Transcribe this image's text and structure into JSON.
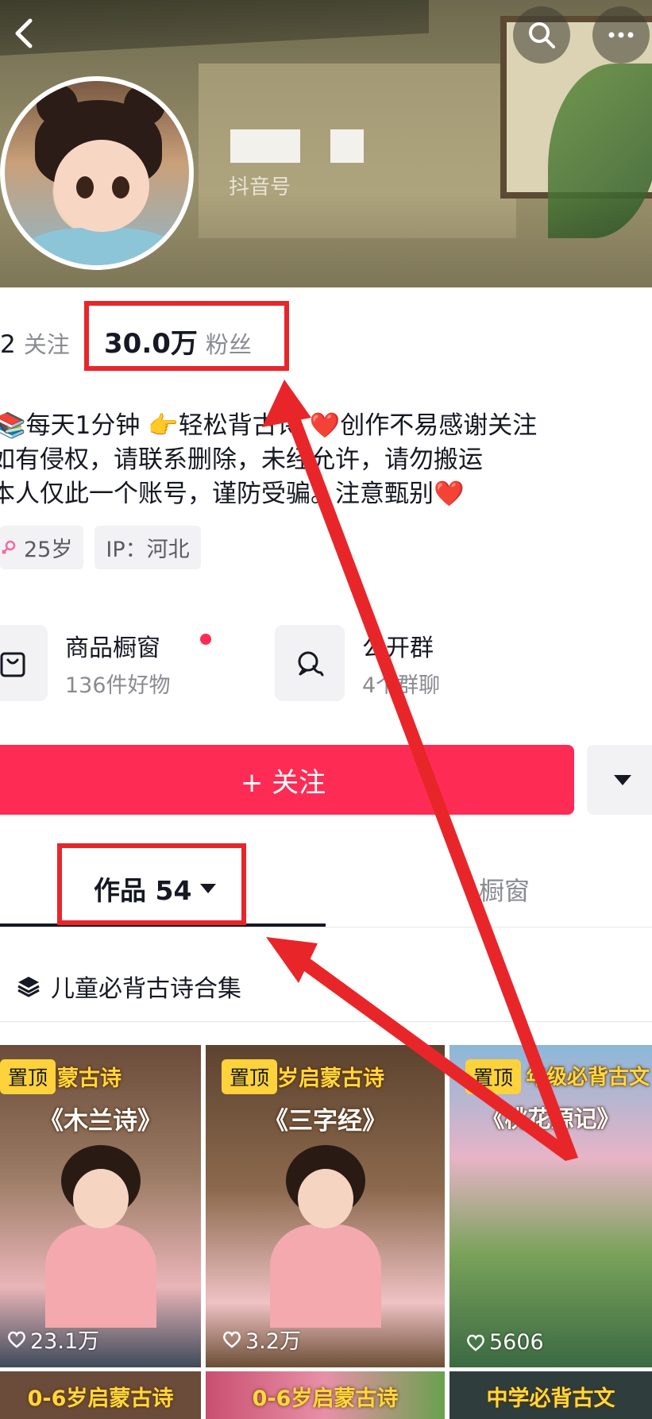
{
  "header": {
    "douyin_id_label": "抖音号"
  },
  "stats": {
    "following_count": "2",
    "following_label": "关注",
    "fans_count": "30.0万",
    "fans_label": "粉丝"
  },
  "bio": {
    "line1": "📚每天1分钟 👉轻松背古诗 ❤️创作不易感谢关注",
    "line2": "如有侵权，请联系删除，未经允许，请勿搬运",
    "line3": "本人仅此一个账号，谨防受骗。注意甄别❤️"
  },
  "tags": {
    "age": "25岁",
    "ip": "IP：河北"
  },
  "shop": {
    "title": "商品橱窗",
    "subtitle": "136件好物"
  },
  "group": {
    "title": "公开群",
    "subtitle": "4个群聊"
  },
  "follow_button": {
    "label": "+ 关注"
  },
  "tabs": {
    "works_label": "作品 54",
    "window_label": "橱窗"
  },
  "collection": {
    "label": "儿童必背古诗合集"
  },
  "videos": [
    {
      "pin": "置顶",
      "title_top": "岁启蒙古诗",
      "title_mid": "《木兰诗》",
      "likes": "23.1万"
    },
    {
      "pin": "置顶",
      "title_top": "岁启蒙古诗",
      "title_mid": "《三字经》",
      "likes": "3.2万"
    },
    {
      "pin": "置顶",
      "title_top": "年级必背古文",
      "title_mid": "《桃花源记》",
      "likes": "5606"
    }
  ],
  "videos_row2": [
    {
      "title_top": "0-6岁启蒙古诗"
    },
    {
      "title_top": "0-6岁启蒙古诗"
    },
    {
      "title_top": "中学必背古文"
    }
  ],
  "colors": {
    "accent": "#fe2c55",
    "annotation": "#e8262a",
    "pin_badge": "#fdd23b"
  },
  "icons": {
    "back": "chevron-left-icon",
    "search": "search-icon",
    "more": "more-dots-icon",
    "shop": "shopping-bag-icon",
    "group": "chat-bubbles-icon",
    "gender": "female-icon",
    "dropdown": "caret-down-icon",
    "collection": "layers-icon",
    "like": "heart-outline-icon"
  }
}
